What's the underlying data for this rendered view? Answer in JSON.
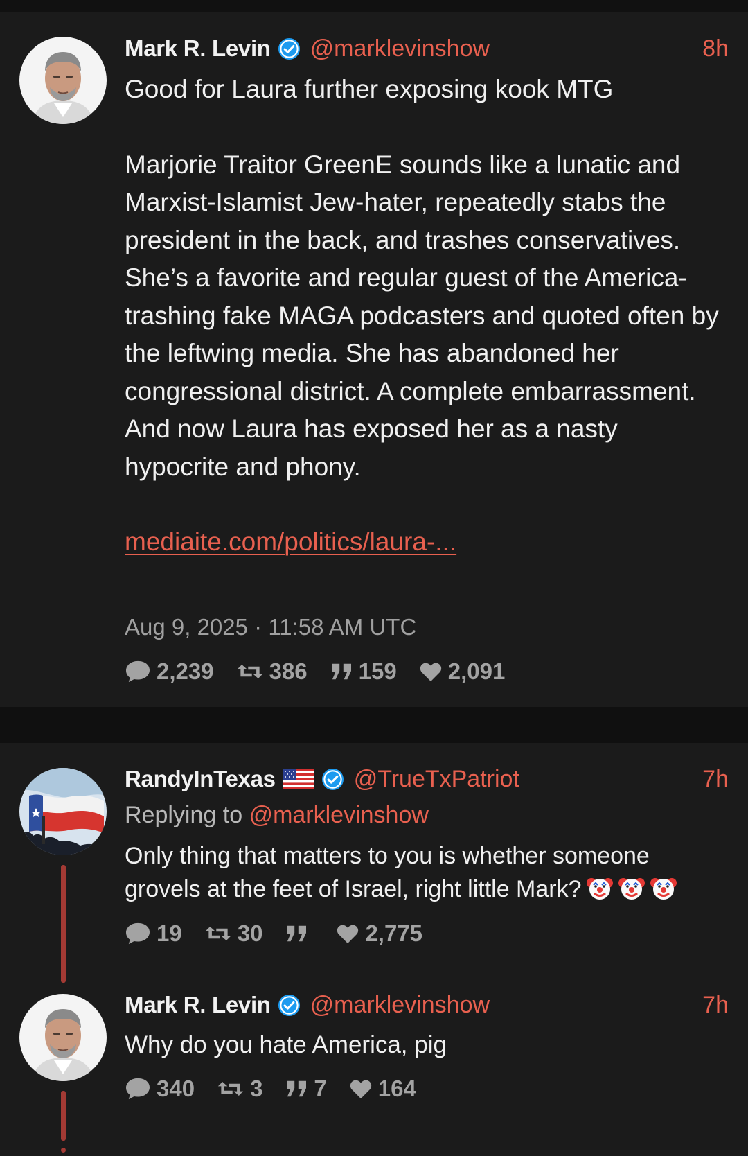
{
  "tweets": [
    {
      "name": "Mark R. Levin",
      "handle": "@marklevinshow",
      "time": "8h",
      "lines": [
        "Good for Laura further exposing kook MTG",
        "Marjorie Traitor GreenE sounds like a lunatic and Marxist-Islamist Jew-hater, repeatedly stabs the president in the back, and trashes conservatives.  She’s a favorite and regular guest of the America-trashing fake MAGA podcasters and quoted often by the leftwing media. She has abandoned her congressional district. A complete embarrassment. And now Laura has exposed her as a nasty hypocrite and phony."
      ],
      "link": "mediaite.com/politics/laura-...",
      "date": "Aug 9, 2025 · 11:58 AM UTC",
      "stats": {
        "comments": "2,239",
        "retweets": "386",
        "quotes": "159",
        "likes": "2,091"
      }
    },
    {
      "name": "RandyInTexas",
      "handle": "@TrueTxPatriot",
      "time": "7h",
      "replying_label": "Replying to",
      "replying_to": "@marklevinshow",
      "text": "Only thing that matters to you is whether someone grovels at the feet of Israel, right little Mark?",
      "emoji": "clown-face-emoji",
      "stats": {
        "comments": "19",
        "retweets": "30",
        "quotes": "",
        "likes": "2,775"
      }
    },
    {
      "name": "Mark R. Levin",
      "handle": "@marklevinshow",
      "time": "7h",
      "text": "Why do you hate America, pig",
      "stats": {
        "comments": "340",
        "retweets": "3",
        "quotes": "7",
        "likes": "164"
      }
    }
  ],
  "colors": {
    "background": "#1b1b1b",
    "accent": "#e8604f",
    "verified": "#1d9bf0",
    "thread_line": "#a33a34"
  }
}
